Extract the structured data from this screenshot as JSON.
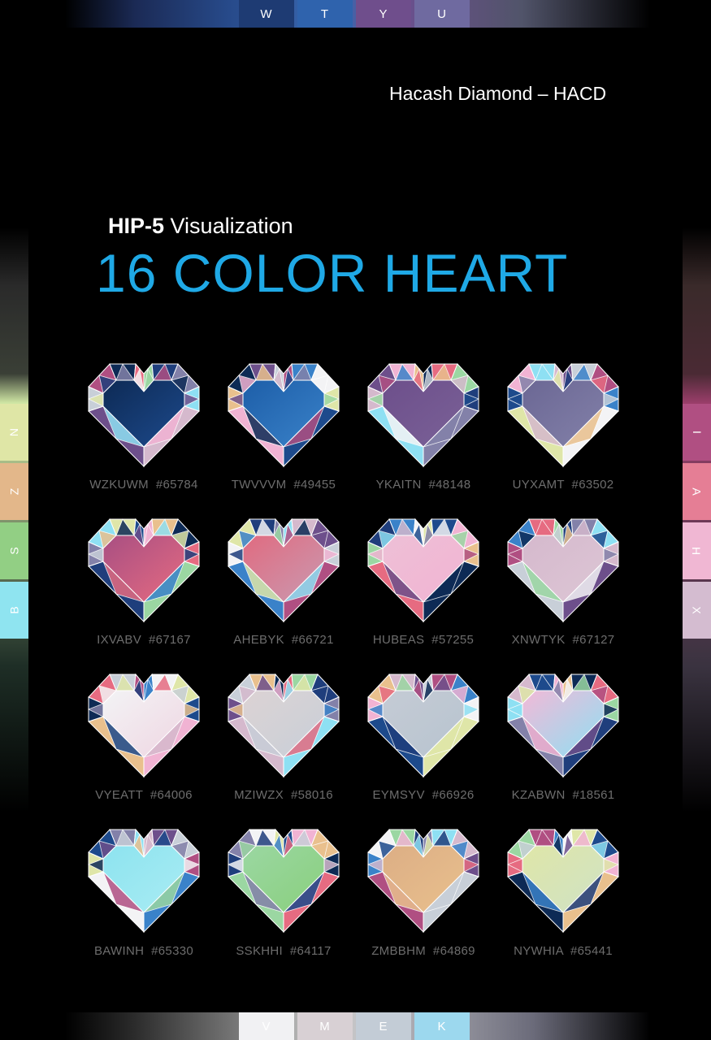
{
  "brand": "Hacash Diamond – HACD",
  "subtitle_bold": "HIP-5",
  "subtitle_rest": " Visualization",
  "title": "16 COLOR HEART",
  "top_letters": [
    {
      "letter": "W",
      "color": "#1e3b73"
    },
    {
      "letter": "T",
      "color": "#2f63ad"
    },
    {
      "letter": "Y",
      "color": "#6f4e8c"
    },
    {
      "letter": "U",
      "color": "#6f6aa0"
    }
  ],
  "bottom_letters": [
    {
      "letter": "V",
      "color": "#f1f1f3"
    },
    {
      "letter": "M",
      "color": "#d8d0d4"
    },
    {
      "letter": "E",
      "color": "#c3ccd6"
    },
    {
      "letter": "K",
      "color": "#9cd8ee"
    }
  ],
  "left_letters": [
    {
      "letter": "N",
      "color": "#dfe6a6"
    },
    {
      "letter": "Z",
      "color": "#e3b78a"
    },
    {
      "letter": "S",
      "color": "#92cf84"
    },
    {
      "letter": "B",
      "color": "#8fe4f0"
    }
  ],
  "right_letters": [
    {
      "letter": "I",
      "color": "#b04f82"
    },
    {
      "letter": "A",
      "color": "#e57e95"
    },
    {
      "letter": "H",
      "color": "#f0b7d3"
    },
    {
      "letter": "X",
      "color": "#d4bcd0"
    }
  ],
  "hearts": [
    {
      "name": "WZKUWM",
      "code": "#65784",
      "c1": "#0d2a55",
      "c2": "#1d4a8c"
    },
    {
      "name": "TWVVVM",
      "code": "#49455",
      "c1": "#1d5ea8",
      "c2": "#3a82c9"
    },
    {
      "name": "YKAITN",
      "code": "#48148",
      "c1": "#6d4f8b",
      "c2": "#7a6197"
    },
    {
      "name": "UYXAMT",
      "code": "#63502",
      "c1": "#6b6794",
      "c2": "#8381a9"
    },
    {
      "name": "IXVABV",
      "code": "#67167",
      "c1": "#a84f82",
      "c2": "#e66b81"
    },
    {
      "name": "AHEBYK",
      "code": "#66721",
      "c1": "#e06b80",
      "c2": "#c99ab1"
    },
    {
      "name": "HUBEAS",
      "code": "#57255",
      "c1": "#eec0d6",
      "c2": "#f1b3d3"
    },
    {
      "name": "XNWTYK",
      "code": "#67127",
      "c1": "#d5b9cd",
      "c2": "#ddc6d5"
    },
    {
      "name": "VYEATT",
      "code": "#64006",
      "c1": "#f3f3f5",
      "c2": "#efd6e2"
    },
    {
      "name": "MZIWZX",
      "code": "#58016",
      "c1": "#dcd3d4",
      "c2": "#c8cfd8"
    },
    {
      "name": "EYMSYV",
      "code": "#66926",
      "c1": "#c5cbd5",
      "c2": "#b7c4cf"
    },
    {
      "name": "KZABWN",
      "code": "#18561",
      "c1": "#f2b9d7",
      "c2": "#8ee0f3"
    },
    {
      "name": "BAWINH",
      "code": "#65330",
      "c1": "#8de3ef",
      "c2": "#a9ecf3"
    },
    {
      "name": "SSKHHI",
      "code": "#64117",
      "c1": "#9bd7a2",
      "c2": "#89cf7d"
    },
    {
      "name": "ZMBBHM",
      "code": "#64869",
      "c1": "#dcae85",
      "c2": "#e9c08d"
    },
    {
      "name": "NYWHIA",
      "code": "#65441",
      "c1": "#dfe6a8",
      "c2": "#cfe2c5"
    }
  ]
}
